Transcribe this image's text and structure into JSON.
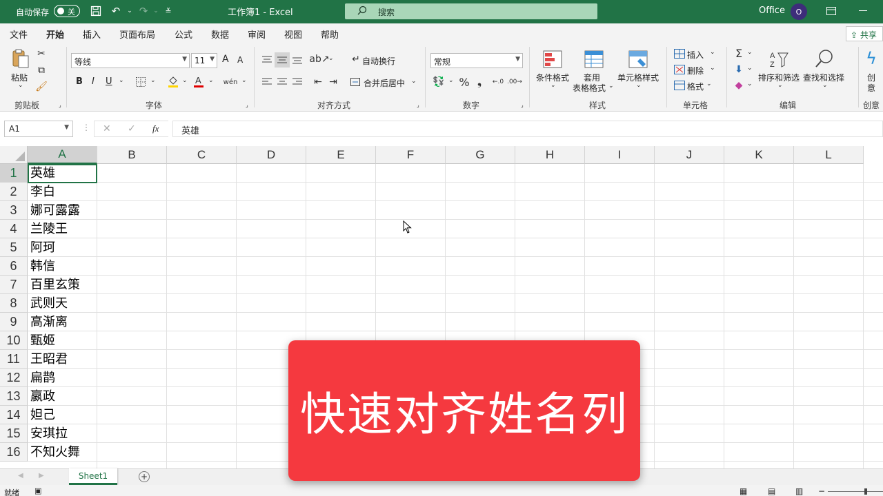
{
  "titlebar": {
    "autosave_label": "自动保存",
    "autosave_state": "关",
    "document_title": "工作簿1  -  Excel",
    "search_placeholder": "搜索",
    "account_name": "Office",
    "avatar_letter": "O"
  },
  "tabs": [
    "文件",
    "开始",
    "插入",
    "页面布局",
    "公式",
    "数据",
    "审阅",
    "视图",
    "帮助"
  ],
  "active_tab": "开始",
  "share_label": "共享",
  "ribbon": {
    "clipboard": {
      "paste": "粘贴",
      "group": "剪贴板"
    },
    "font": {
      "font_name": "等线",
      "font_size": "11",
      "grow": "A",
      "shrink": "A",
      "bold": "B",
      "italic": "I",
      "underline": "U",
      "group": "字体"
    },
    "alignment": {
      "wrap": "自动换行",
      "merge": "合并后居中",
      "group": "对齐方式"
    },
    "number": {
      "format": "常规",
      "group": "数字"
    },
    "styles": {
      "conditional": "条件格式",
      "table1": "套用",
      "table2": "表格格式",
      "cell_styles": "单元格样式",
      "group": "样式"
    },
    "cells": {
      "insert": "插入",
      "delete": "删除",
      "format": "格式",
      "group": "单元格"
    },
    "editing": {
      "sort": "排序和筛选",
      "find": "查找和选择",
      "group": "编辑"
    },
    "ideas": {
      "label1": "创",
      "label2": "意",
      "group": "创意"
    }
  },
  "formula_bar": {
    "name_box": "A1",
    "fx": "fx",
    "value": "英雄"
  },
  "columns": [
    "A",
    "B",
    "C",
    "D",
    "E",
    "F",
    "G",
    "H",
    "I",
    "J",
    "K",
    "L"
  ],
  "rows": [
    "1",
    "2",
    "3",
    "4",
    "5",
    "6",
    "7",
    "8",
    "9",
    "10",
    "11",
    "12",
    "13",
    "14",
    "15",
    "16"
  ],
  "cells_a": [
    "英雄",
    "李白",
    "娜可露露",
    "兰陵王",
    "阿珂",
    "韩信",
    "百里玄策",
    "武则天",
    "高渐离",
    "甄姬",
    "王昭君",
    "扁鹊",
    "嬴政",
    "妲己",
    "安琪拉",
    "不知火舞"
  ],
  "sheet_tab": "Sheet1",
  "status": {
    "ready": "就绪"
  },
  "overlay": {
    "text": "快速对齐姓名列",
    "color": "#f5393f"
  },
  "colors": {
    "accent": "#217346"
  }
}
